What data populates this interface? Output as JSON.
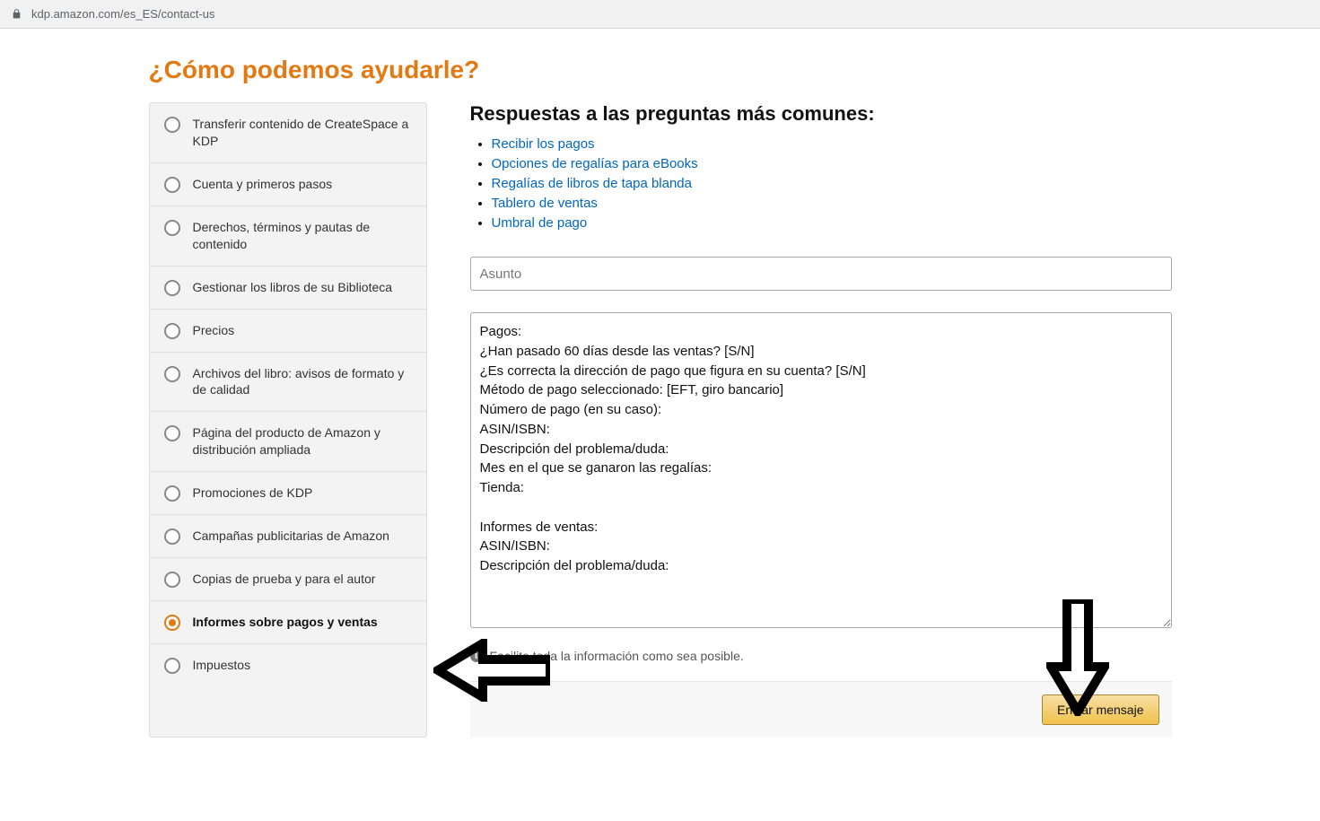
{
  "url": "kdp.amazon.com/es_ES/contact-us",
  "title": "¿Cómo podemos ayudarle?",
  "sidebar": {
    "items": [
      {
        "label": "Transferir contenido de CreateSpace a KDP",
        "selected": false
      },
      {
        "label": "Cuenta y primeros pasos",
        "selected": false
      },
      {
        "label": "Derechos, términos y pautas de contenido",
        "selected": false
      },
      {
        "label": "Gestionar los libros de su Biblioteca",
        "selected": false
      },
      {
        "label": "Precios",
        "selected": false
      },
      {
        "label": "Archivos del libro: avisos de formato y de calidad",
        "selected": false
      },
      {
        "label": "Página del producto de Amazon y distribución ampliada",
        "selected": false
      },
      {
        "label": "Promociones de KDP",
        "selected": false
      },
      {
        "label": "Campañas publicitarias de Amazon",
        "selected": false
      },
      {
        "label": "Copias de prueba y para el autor",
        "selected": false
      },
      {
        "label": "Informes sobre pagos y ventas",
        "selected": true
      },
      {
        "label": "Impuestos",
        "selected": false
      }
    ]
  },
  "common": {
    "heading": "Respuestas a las preguntas más comunes:",
    "links": [
      "Recibir los pagos",
      "Opciones de regalías para eBooks",
      "Regalías de libros de tapa blanda",
      "Tablero de ventas",
      "Umbral de pago"
    ]
  },
  "form": {
    "subject_placeholder": "Asunto",
    "subject_value": "",
    "body": "Pagos:\n¿Han pasado 60 días desde las ventas? [S/N]\n¿Es correcta la dirección de pago que figura en su cuenta? [S/N]\nMétodo de pago seleccionado: [EFT, giro bancario]\nNúmero de pago (en su caso):\nASIN/ISBN:\nDescripción del problema/duda:\nMes en el que se ganaron las regalías:\nTienda:\n\nInformes de ventas:\nASIN/ISBN:\nDescripción del problema/duda:",
    "tip": "Facilite toda la información como sea posible.",
    "submit": "Enviar mensaje"
  }
}
